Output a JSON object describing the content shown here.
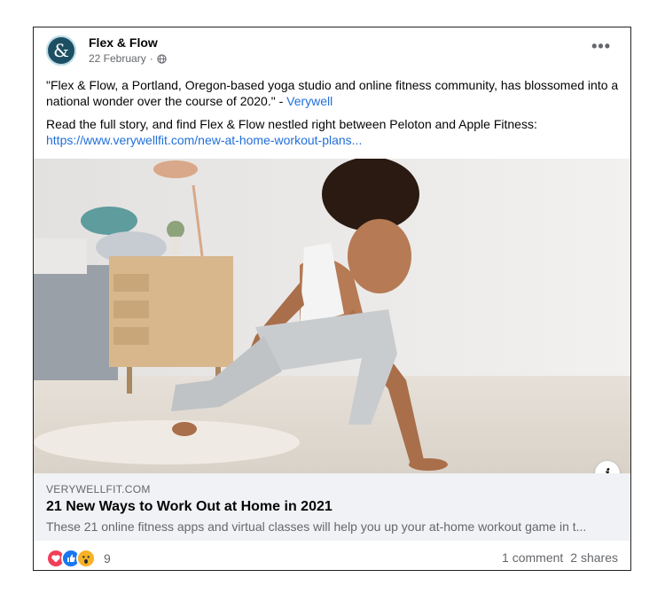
{
  "post": {
    "page_name": "Flex & Flow",
    "date": "22 February",
    "date_separator": "·",
    "more_label": "•••",
    "quote_text": "\"Flex & Flow, a Portland, Oregon-based yoga studio and online fitness community, has blossomed into a national wonder over the course of 2020.\" - ",
    "quote_source": "Verywell",
    "body_text": "Read the full story, and find Flex & Flow nestled right between Peloton and Apple Fitness:",
    "body_link": "https://www.verywellfit.com/new-at-home-workout-plans..."
  },
  "link_preview": {
    "domain": "VERYWELLFIT.COM",
    "title": "21 New Ways to Work Out at Home in 2021",
    "description": "These 21 online fitness apps and virtual classes will help you up your at-home workout game in t...",
    "info_label": "i"
  },
  "footer": {
    "reaction_icons": [
      "heart-icon",
      "like-icon",
      "wow-icon"
    ],
    "reaction_count": "9",
    "comments": "1 comment",
    "shares": "2 shares"
  },
  "colors": {
    "link": "#216fdb",
    "avatar": "#1d4f63",
    "preview_bg": "#f0f2f5"
  }
}
